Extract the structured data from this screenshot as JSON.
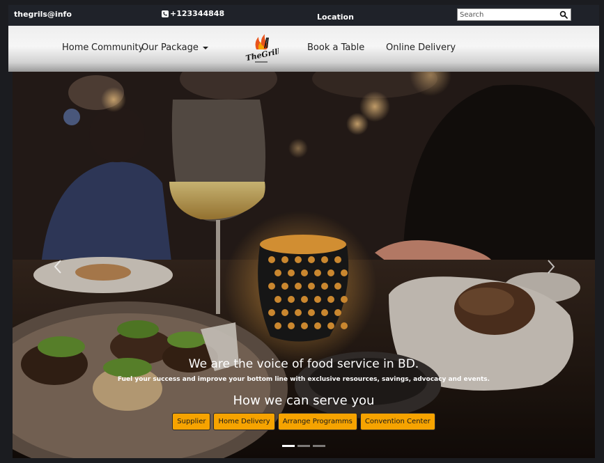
{
  "topbar": {
    "email": "thegrils@info",
    "phone": "+123344848",
    "location": "Location",
    "search_placeholder": "Search"
  },
  "nav": {
    "home": "Home",
    "community": "Community",
    "package": "Our Package",
    "book": "Book a Table",
    "delivery": "Online Delivery",
    "logo_text": "TheGrill"
  },
  "hero": {
    "title": "We are the voice of food service in BD.",
    "subtitle": "Fuel your success and improve your bottom line with exclusive resources, savings, advocacy and events.",
    "serve_heading": "How we can serve you",
    "buttons": [
      "Supplier",
      "Home Delivery",
      "Arrange Programms",
      "Convention Center"
    ],
    "slides_count": 3,
    "active_slide": 1
  },
  "colors": {
    "accent": "#f6a300",
    "topbar_bg": "#1f2229"
  }
}
